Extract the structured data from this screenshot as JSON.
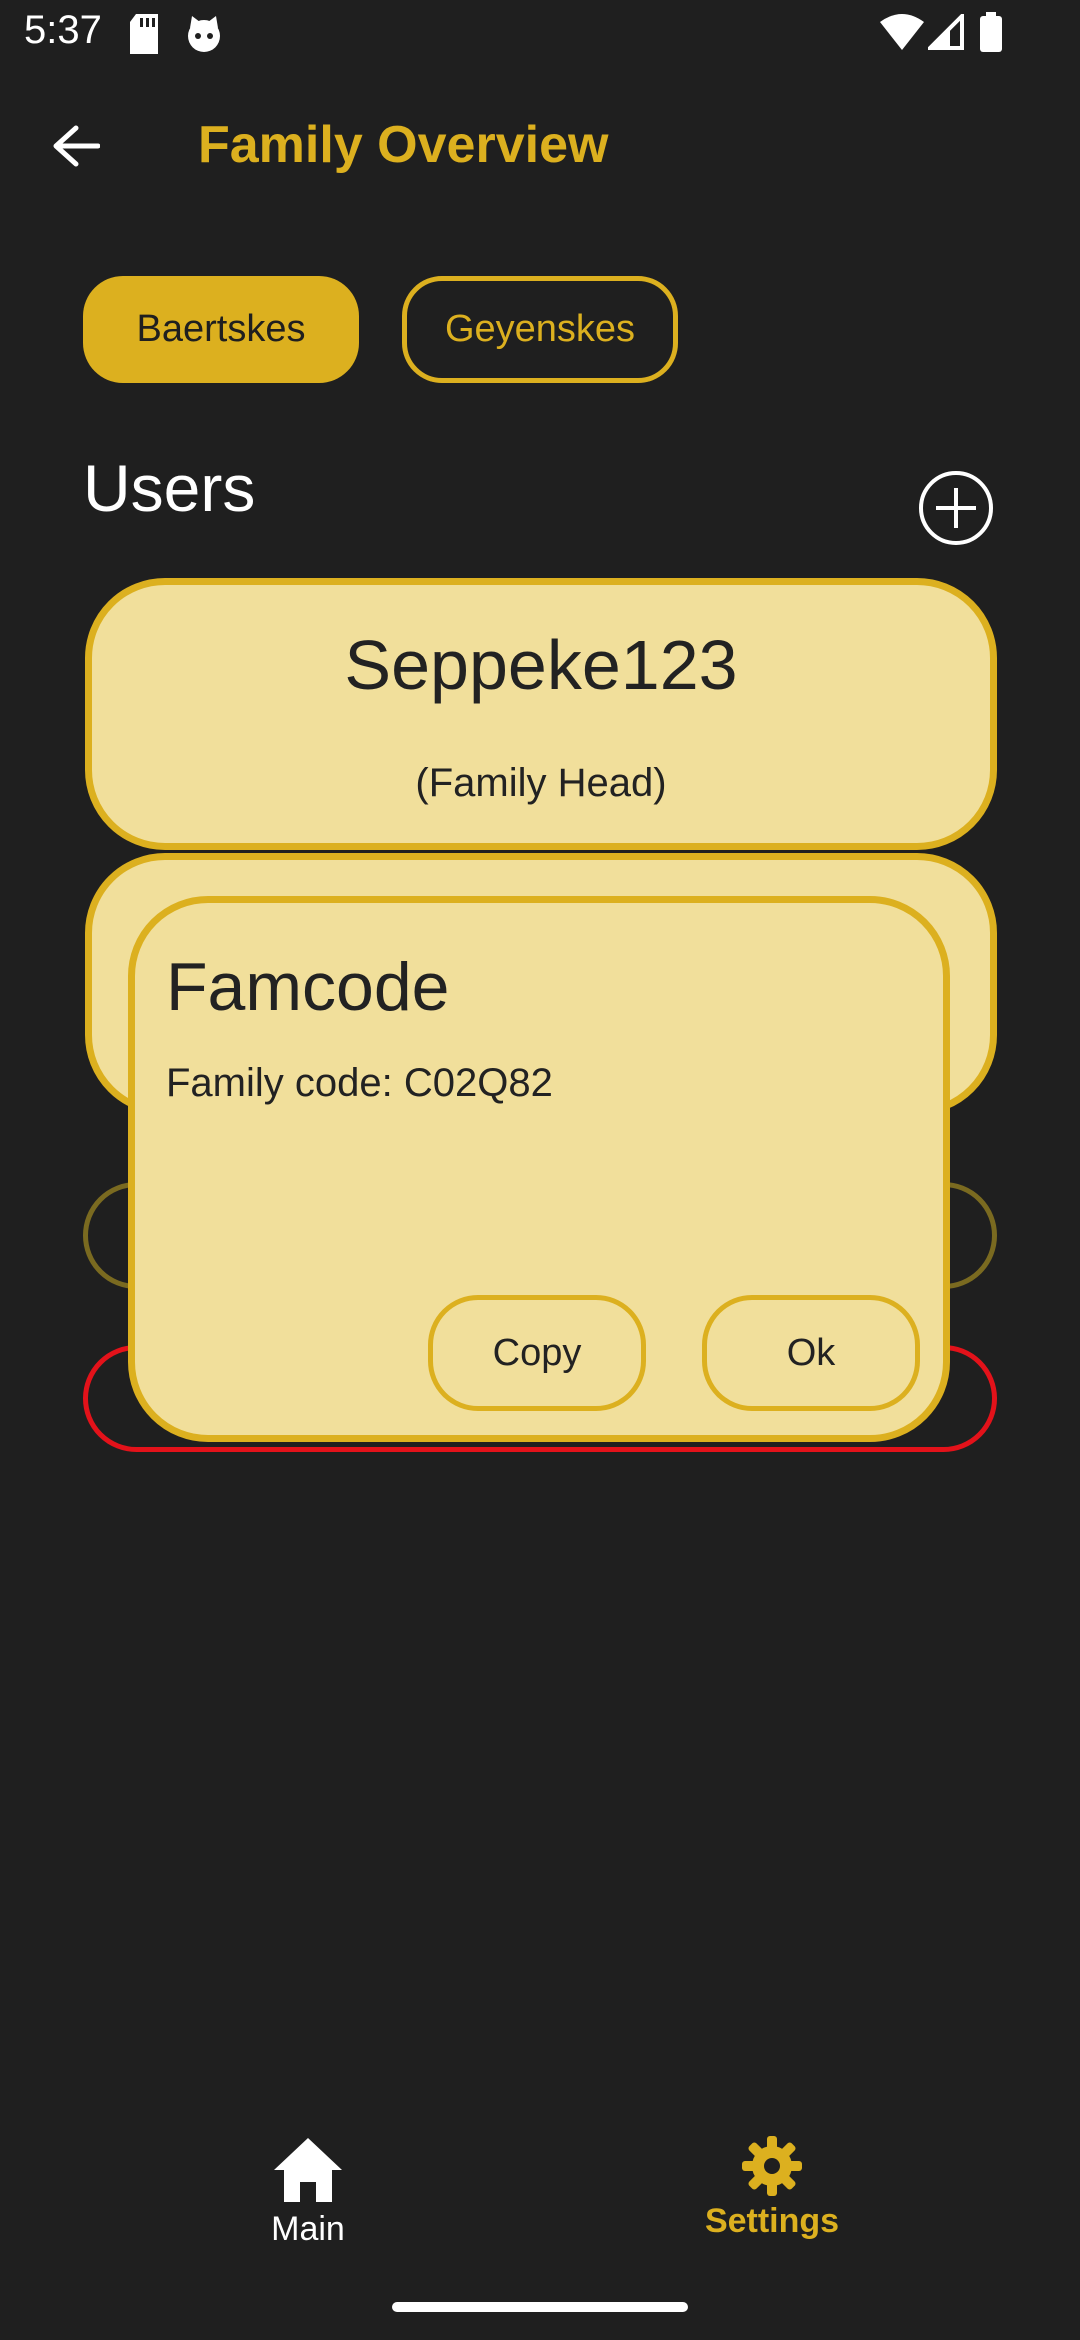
{
  "status_bar": {
    "time": "5:37",
    "icons": [
      "sd-card-icon",
      "cat-icon",
      "wifi-icon",
      "signal-icon",
      "battery-icon"
    ]
  },
  "app_bar": {
    "back_icon": "arrow-left-icon",
    "title": "Family Overview"
  },
  "families": [
    {
      "label": "Baertskes",
      "selected": true
    },
    {
      "label": "Geyenskes",
      "selected": false
    }
  ],
  "users_section": {
    "heading": "Users",
    "add_icon": "plus-circle-icon",
    "users": [
      {
        "name": "Seppeke123",
        "role": "(Family Head)"
      },
      {
        "name": "",
        "role": ""
      }
    ]
  },
  "dialog": {
    "title": "Famcode",
    "message": "Family code: C02Q82",
    "copy_label": "Copy",
    "ok_label": "Ok"
  },
  "bottom_nav": {
    "items": [
      {
        "label": "Main",
        "icon": "home-icon",
        "active": false
      },
      {
        "label": "Settings",
        "icon": "gear-icon",
        "active": true
      }
    ]
  },
  "colors": {
    "accent": "#dcb01f",
    "card": "#f1df9b",
    "background": "#1f1f1f",
    "danger": "#e3121a"
  }
}
